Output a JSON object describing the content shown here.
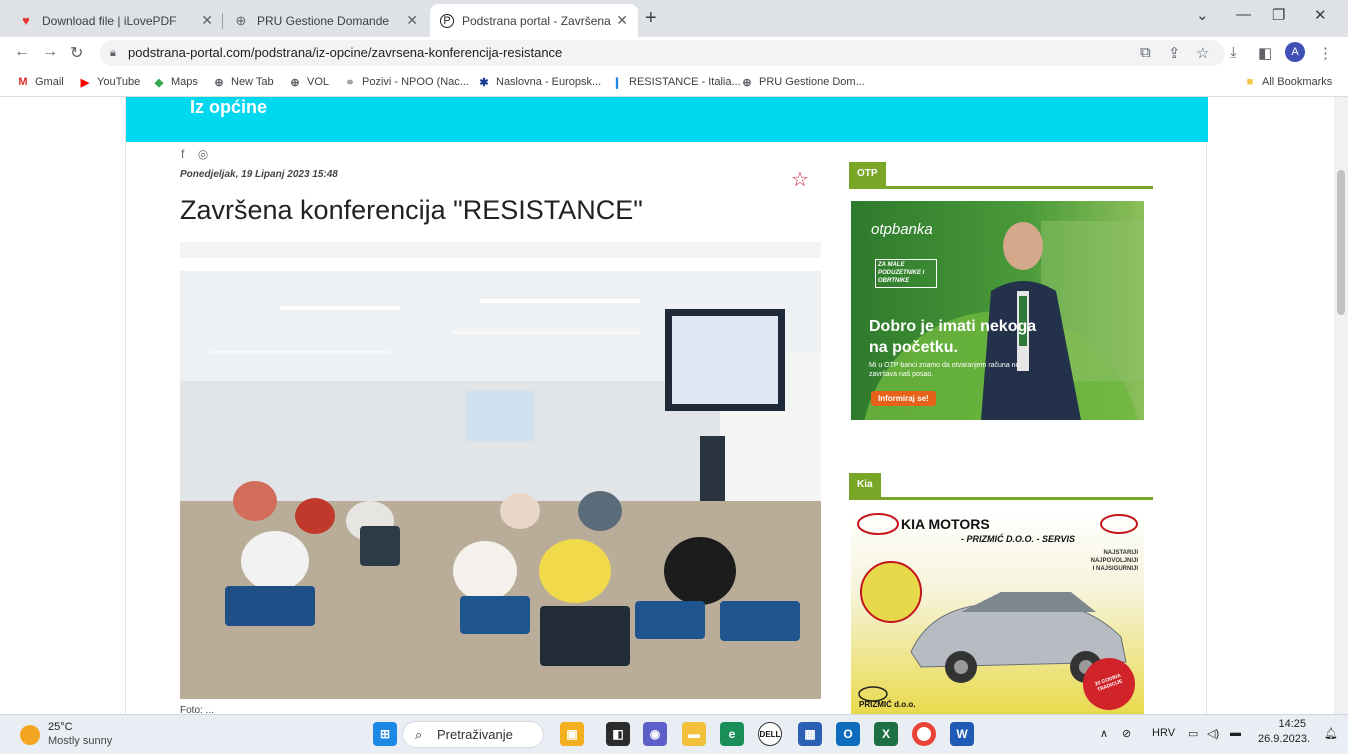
{
  "tabs": [
    {
      "label": "Download file | iLovePDF",
      "icon": "heart-icon"
    },
    {
      "label": "PRU Gestione Domande",
      "icon": "globe-icon"
    },
    {
      "label": "Podstrana portal - Završena konf",
      "icon": "site-icon"
    }
  ],
  "address": {
    "url": "podstrana-portal.com/podstrana/iz-opcine/zavrsena-konferencija-resistance"
  },
  "profile_initial": "A",
  "bookmarks": [
    {
      "label": "Gmail"
    },
    {
      "label": "YouTube"
    },
    {
      "label": "Maps"
    },
    {
      "label": "New Tab"
    },
    {
      "label": "VOL"
    },
    {
      "label": "Pozivi - NPOO (Nac..."
    },
    {
      "label": "Naslovna - Europsk..."
    },
    {
      "label": "RESISTANCE - Italia..."
    },
    {
      "label": "PRU Gestione Dom..."
    }
  ],
  "all_bookmarks": "All Bookmarks",
  "page": {
    "section": "Iz općine",
    "date": "Ponedjeljak, 19 Lipanj 2023 15:48",
    "title": "Završena konferencija \"RESISTANCE\"",
    "caption": "Foto: ..."
  },
  "ads": {
    "otp": {
      "label": "OTP",
      "brand": "otpbanka",
      "badge": "ZA MALE PODUZETNIKE I OBRTNIKE",
      "headline1": "Dobro je imati nekoga",
      "headline2": "na početku.",
      "sub": "Mi u OTP banci znamo da otvaranjem računa ne završava naš posao.",
      "cta": "Informiraj se!"
    },
    "kia": {
      "label": "Kia",
      "brand": "KIA MOTORS",
      "sub": "- PRIZMIĆ D.O.O. - SERVIS",
      "tag1": "NAJSTARIJI",
      "tag2": "NAJPOVOLJNIJI",
      "tag3": "I NAJSIGURNIJI",
      "footer": "PRIZMIĆ d.o.o.",
      "years": "20 GODINA TRADICIJE"
    }
  },
  "taskbar": {
    "weather_temp": "25°C",
    "weather_desc": "Mostly sunny",
    "search_placeholder": "Pretraživanje",
    "lang": "HRV",
    "time": "14:25",
    "date": "26.9.2023."
  },
  "colors": {
    "accent_cyan": "#00d8f0",
    "ad_green": "#7aa628",
    "star_red": "#d81b2c"
  }
}
